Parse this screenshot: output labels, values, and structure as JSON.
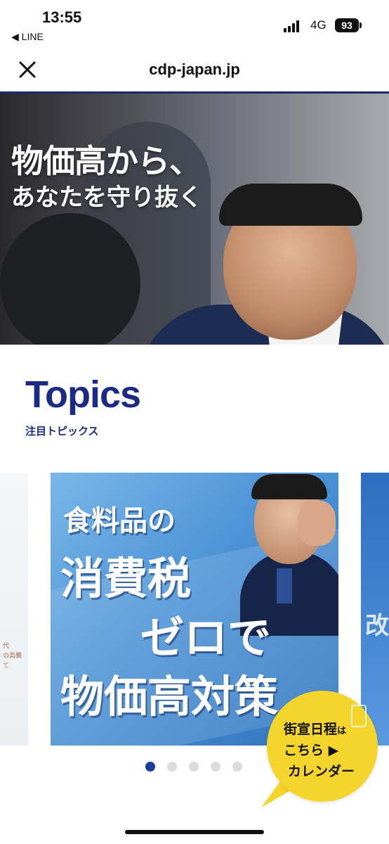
{
  "status_bar": {
    "time": "13:55",
    "back_app": "◀ LINE",
    "network": "4G",
    "battery": "93"
  },
  "browser": {
    "url": "cdp-japan.jp",
    "close_icon": "close-icon"
  },
  "hero": {
    "line1": "物価高から、",
    "line2": "あなたを守り抜く"
  },
  "topics": {
    "title": "Topics",
    "subtitle": "注目トピックス"
  },
  "carousel": {
    "left_partial_text": "代\nの高騰\nて",
    "main_slide": {
      "line1": "食料品の",
      "line2": "消費税",
      "line3": "ゼロで",
      "line4": "物価高対策"
    },
    "right_partial_text": "改",
    "page_count": 5,
    "active_index": 0
  },
  "calendar_badge": {
    "line1_main": "街宣日程",
    "line1_small": "は",
    "line2": "こちら ▶",
    "line3": "カレンダー"
  },
  "colors": {
    "brand_navy": "#1b2a85",
    "dot_active": "#1b3a9c",
    "badge_yellow": "#f5d52b"
  }
}
